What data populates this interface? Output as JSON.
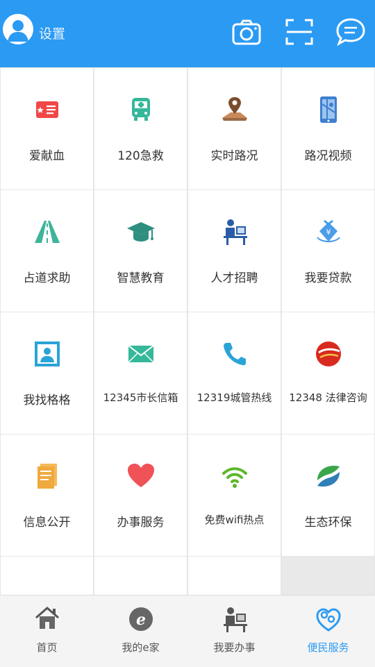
{
  "header": {
    "settings_label": "设置",
    "icons": [
      "avatar-icon",
      "camera-icon",
      "scan-icon",
      "message-icon"
    ]
  },
  "services": [
    {
      "label": "爱献血",
      "icon": "blood-card-icon"
    },
    {
      "label": "120急救",
      "icon": "ambulance-icon"
    },
    {
      "label": "实时路况",
      "icon": "map-pin-icon"
    },
    {
      "label": "路况视频",
      "icon": "phone-map-icon"
    },
    {
      "label": "占道求助",
      "icon": "road-icon"
    },
    {
      "label": "智慧教育",
      "icon": "graduation-cap-icon"
    },
    {
      "label": "人才招聘",
      "icon": "office-worker-icon"
    },
    {
      "label": "我要贷款",
      "icon": "loan-bag-icon"
    },
    {
      "label": "我找格格",
      "icon": "contact-card-icon"
    },
    {
      "label": "12345市长信箱",
      "icon": "mail-icon"
    },
    {
      "label": "12319城管热线",
      "icon": "phone-icon"
    },
    {
      "label": "12348 法律咨询",
      "icon": "law-logo-icon"
    },
    {
      "label": "信息公开",
      "icon": "document-icon"
    },
    {
      "label": "办事服务",
      "icon": "heart-icon"
    },
    {
      "label": "免费wifi热点",
      "icon": "wifi-icon"
    },
    {
      "label": "生态环保",
      "icon": "eco-leaf-icon"
    }
  ],
  "tabs": [
    {
      "label": "首页",
      "icon": "home-icon"
    },
    {
      "label": "我的e家",
      "icon": "e-home-icon"
    },
    {
      "label": "我要办事",
      "icon": "office-icon"
    },
    {
      "label": "便民服务",
      "icon": "convenience-service-icon",
      "active": true
    }
  ],
  "colors": {
    "header": "#2b9af3",
    "active_tab": "#2b9af3"
  }
}
